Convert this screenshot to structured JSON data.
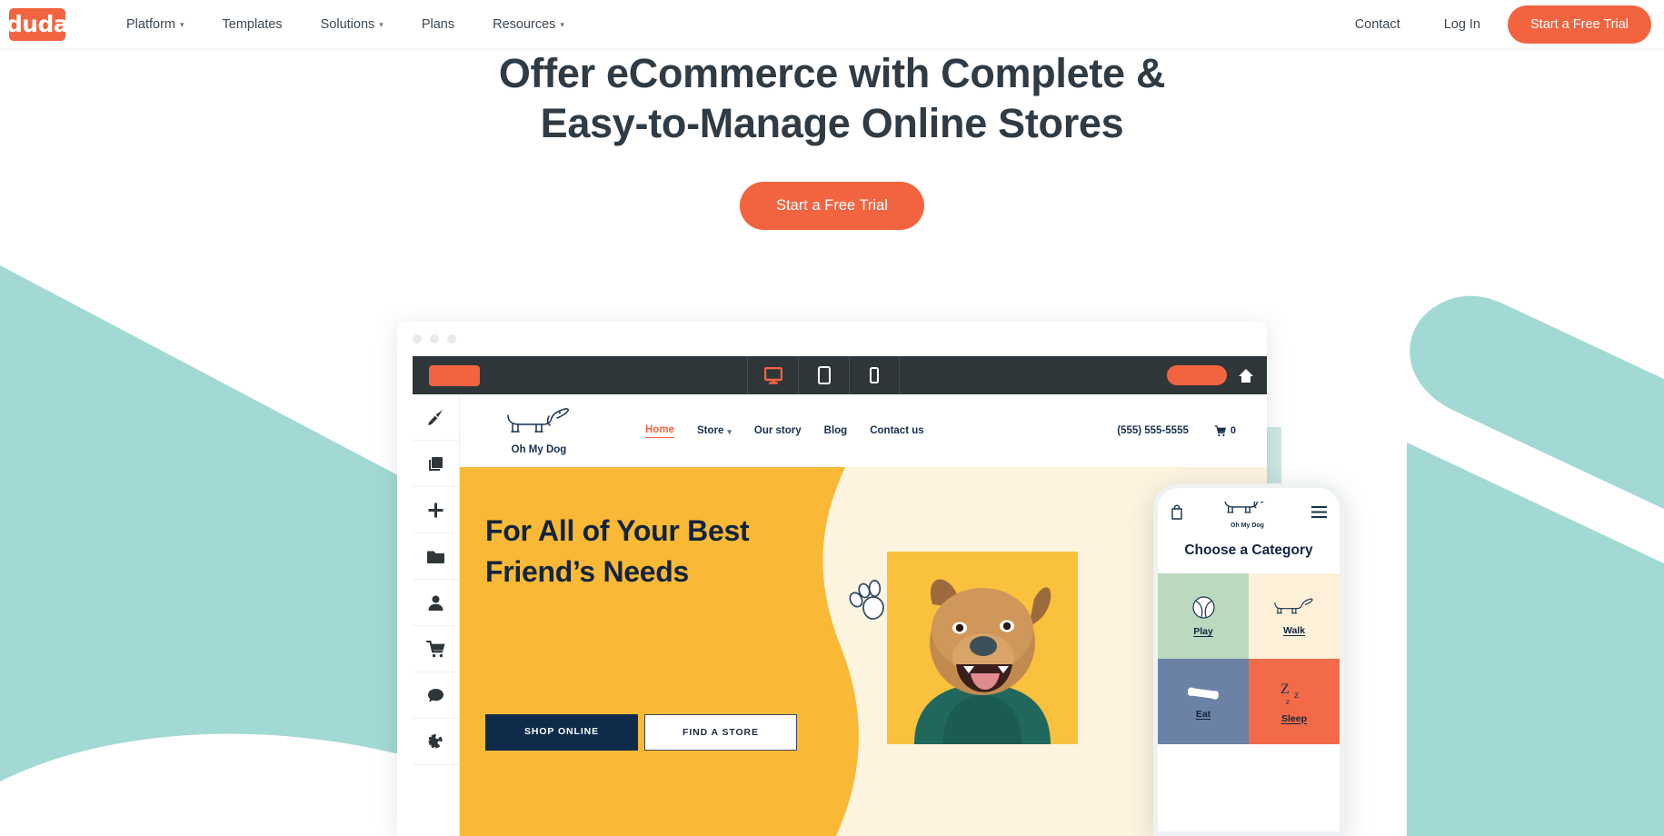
{
  "brand": {
    "name": "duda",
    "accent": "#f26440"
  },
  "topnav": {
    "links": [
      {
        "label": "Platform",
        "has_caret": true
      },
      {
        "label": "Templates",
        "has_caret": false
      },
      {
        "label": "Solutions",
        "has_caret": true
      },
      {
        "label": "Plans",
        "has_caret": false
      },
      {
        "label": "Resources",
        "has_caret": true
      }
    ],
    "right_links": [
      {
        "label": "Contact"
      },
      {
        "label": "Log In"
      }
    ],
    "cta_label": "Start a Free Trial"
  },
  "hero": {
    "heading_line1": "Offer eCommerce with Complete &",
    "heading_line2": "Easy-to-Manage Online Stores",
    "cta_label": "Start a Free Trial"
  },
  "editor": {
    "devices": [
      {
        "name": "desktop-view",
        "active": true
      },
      {
        "name": "tablet-view",
        "active": false
      },
      {
        "name": "mobile-view",
        "active": false
      }
    ],
    "rail_items": [
      {
        "icon": "brush-icon"
      },
      {
        "icon": "layers-icon"
      },
      {
        "icon": "plus-icon"
      },
      {
        "icon": "folder-icon"
      },
      {
        "icon": "person-icon"
      },
      {
        "icon": "cart-icon"
      },
      {
        "icon": "chat-icon"
      },
      {
        "icon": "puzzle-icon"
      }
    ]
  },
  "site": {
    "logo_name": "Oh My Dog",
    "nav": [
      {
        "label": "Home",
        "active": true,
        "has_caret": false
      },
      {
        "label": "Store",
        "active": false,
        "has_caret": true
      },
      {
        "label": "Our story",
        "active": false,
        "has_caret": false
      },
      {
        "label": "Blog",
        "active": false,
        "has_caret": false
      },
      {
        "label": "Contact us",
        "active": false,
        "has_caret": false
      }
    ],
    "phone": "(555) 555-5555",
    "cart_count": "0",
    "hero_heading": "For All of Your Best Friend’s Needs",
    "btn_shop": "SHOP ONLINE",
    "btn_find": "FIND A STORE",
    "colors": {
      "amber": "#f9b936",
      "cream": "#fdf4e0",
      "navy": "#12243f"
    }
  },
  "mobile": {
    "logo_name": "Oh My Dog",
    "title": "Choose a Category",
    "tiles": [
      {
        "label": "Play",
        "icon": "tennis-ball-icon",
        "bg": "#bcd9c0"
      },
      {
        "label": "Walk",
        "icon": "dog-walk-icon",
        "bg": "#fdf0d8"
      },
      {
        "label": "Eat",
        "icon": "bone-icon",
        "bg": "#6b82a4"
      },
      {
        "label": "Sleep",
        "icon": "sleep-zzz-icon",
        "bg": "#f26a48"
      }
    ]
  }
}
